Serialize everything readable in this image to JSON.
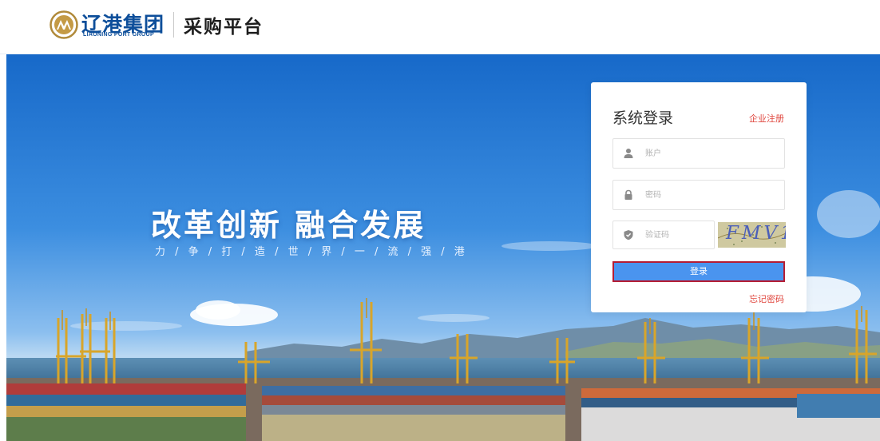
{
  "header": {
    "brand_cn": "辽港集团",
    "brand_en": "LIAONING PORT GROUP",
    "platform_name": "采购平台"
  },
  "banner": {
    "slogan_main": "改革创新 融合发展",
    "slogan_sub": "力 / 争 / 打 / 造 / 世 / 界 / 一 / 流 / 强 / 港"
  },
  "login": {
    "title": "系统登录",
    "register_label": "企业注册",
    "username_placeholder": "账户",
    "password_placeholder": "密码",
    "captcha_placeholder": "验证码",
    "captcha_text": "FMV1",
    "submit_label": "登录",
    "forgot_label": "忘记密码"
  },
  "colors": {
    "brand_blue": "#0d4e9a",
    "accent_red": "#e0473f",
    "button_blue": "#4a94ef",
    "button_border": "#b51d34"
  },
  "icons": [
    "logo-mark",
    "user-icon",
    "lock-icon",
    "shield-icon"
  ]
}
